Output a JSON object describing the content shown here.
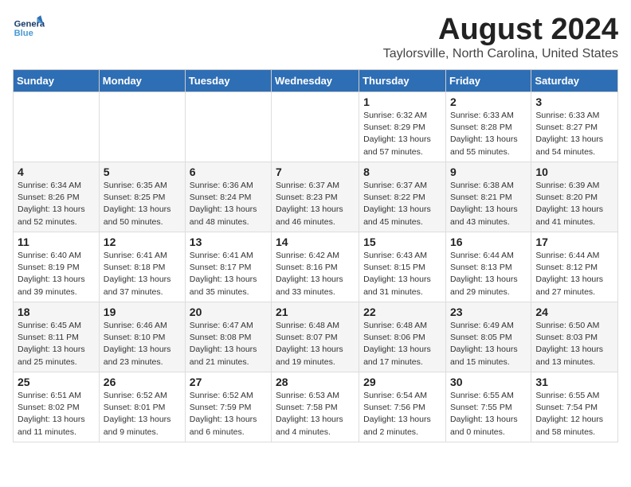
{
  "header": {
    "logo_line1": "General",
    "logo_line2": "Blue",
    "month_title": "August 2024",
    "subtitle": "Taylorsville, North Carolina, United States"
  },
  "days_of_week": [
    "Sunday",
    "Monday",
    "Tuesday",
    "Wednesday",
    "Thursday",
    "Friday",
    "Saturday"
  ],
  "weeks": [
    [
      {
        "day": "",
        "info": ""
      },
      {
        "day": "",
        "info": ""
      },
      {
        "day": "",
        "info": ""
      },
      {
        "day": "",
        "info": ""
      },
      {
        "day": "1",
        "info": "Sunrise: 6:32 AM\nSunset: 8:29 PM\nDaylight: 13 hours\nand 57 minutes."
      },
      {
        "day": "2",
        "info": "Sunrise: 6:33 AM\nSunset: 8:28 PM\nDaylight: 13 hours\nand 55 minutes."
      },
      {
        "day": "3",
        "info": "Sunrise: 6:33 AM\nSunset: 8:27 PM\nDaylight: 13 hours\nand 54 minutes."
      }
    ],
    [
      {
        "day": "4",
        "info": "Sunrise: 6:34 AM\nSunset: 8:26 PM\nDaylight: 13 hours\nand 52 minutes."
      },
      {
        "day": "5",
        "info": "Sunrise: 6:35 AM\nSunset: 8:25 PM\nDaylight: 13 hours\nand 50 minutes."
      },
      {
        "day": "6",
        "info": "Sunrise: 6:36 AM\nSunset: 8:24 PM\nDaylight: 13 hours\nand 48 minutes."
      },
      {
        "day": "7",
        "info": "Sunrise: 6:37 AM\nSunset: 8:23 PM\nDaylight: 13 hours\nand 46 minutes."
      },
      {
        "day": "8",
        "info": "Sunrise: 6:37 AM\nSunset: 8:22 PM\nDaylight: 13 hours\nand 45 minutes."
      },
      {
        "day": "9",
        "info": "Sunrise: 6:38 AM\nSunset: 8:21 PM\nDaylight: 13 hours\nand 43 minutes."
      },
      {
        "day": "10",
        "info": "Sunrise: 6:39 AM\nSunset: 8:20 PM\nDaylight: 13 hours\nand 41 minutes."
      }
    ],
    [
      {
        "day": "11",
        "info": "Sunrise: 6:40 AM\nSunset: 8:19 PM\nDaylight: 13 hours\nand 39 minutes."
      },
      {
        "day": "12",
        "info": "Sunrise: 6:41 AM\nSunset: 8:18 PM\nDaylight: 13 hours\nand 37 minutes."
      },
      {
        "day": "13",
        "info": "Sunrise: 6:41 AM\nSunset: 8:17 PM\nDaylight: 13 hours\nand 35 minutes."
      },
      {
        "day": "14",
        "info": "Sunrise: 6:42 AM\nSunset: 8:16 PM\nDaylight: 13 hours\nand 33 minutes."
      },
      {
        "day": "15",
        "info": "Sunrise: 6:43 AM\nSunset: 8:15 PM\nDaylight: 13 hours\nand 31 minutes."
      },
      {
        "day": "16",
        "info": "Sunrise: 6:44 AM\nSunset: 8:13 PM\nDaylight: 13 hours\nand 29 minutes."
      },
      {
        "day": "17",
        "info": "Sunrise: 6:44 AM\nSunset: 8:12 PM\nDaylight: 13 hours\nand 27 minutes."
      }
    ],
    [
      {
        "day": "18",
        "info": "Sunrise: 6:45 AM\nSunset: 8:11 PM\nDaylight: 13 hours\nand 25 minutes."
      },
      {
        "day": "19",
        "info": "Sunrise: 6:46 AM\nSunset: 8:10 PM\nDaylight: 13 hours\nand 23 minutes."
      },
      {
        "day": "20",
        "info": "Sunrise: 6:47 AM\nSunset: 8:08 PM\nDaylight: 13 hours\nand 21 minutes."
      },
      {
        "day": "21",
        "info": "Sunrise: 6:48 AM\nSunset: 8:07 PM\nDaylight: 13 hours\nand 19 minutes."
      },
      {
        "day": "22",
        "info": "Sunrise: 6:48 AM\nSunset: 8:06 PM\nDaylight: 13 hours\nand 17 minutes."
      },
      {
        "day": "23",
        "info": "Sunrise: 6:49 AM\nSunset: 8:05 PM\nDaylight: 13 hours\nand 15 minutes."
      },
      {
        "day": "24",
        "info": "Sunrise: 6:50 AM\nSunset: 8:03 PM\nDaylight: 13 hours\nand 13 minutes."
      }
    ],
    [
      {
        "day": "25",
        "info": "Sunrise: 6:51 AM\nSunset: 8:02 PM\nDaylight: 13 hours\nand 11 minutes."
      },
      {
        "day": "26",
        "info": "Sunrise: 6:52 AM\nSunset: 8:01 PM\nDaylight: 13 hours\nand 9 minutes."
      },
      {
        "day": "27",
        "info": "Sunrise: 6:52 AM\nSunset: 7:59 PM\nDaylight: 13 hours\nand 6 minutes."
      },
      {
        "day": "28",
        "info": "Sunrise: 6:53 AM\nSunset: 7:58 PM\nDaylight: 13 hours\nand 4 minutes."
      },
      {
        "day": "29",
        "info": "Sunrise: 6:54 AM\nSunset: 7:56 PM\nDaylight: 13 hours\nand 2 minutes."
      },
      {
        "day": "30",
        "info": "Sunrise: 6:55 AM\nSunset: 7:55 PM\nDaylight: 13 hours\nand 0 minutes."
      },
      {
        "day": "31",
        "info": "Sunrise: 6:55 AM\nSunset: 7:54 PM\nDaylight: 12 hours\nand 58 minutes."
      }
    ]
  ]
}
